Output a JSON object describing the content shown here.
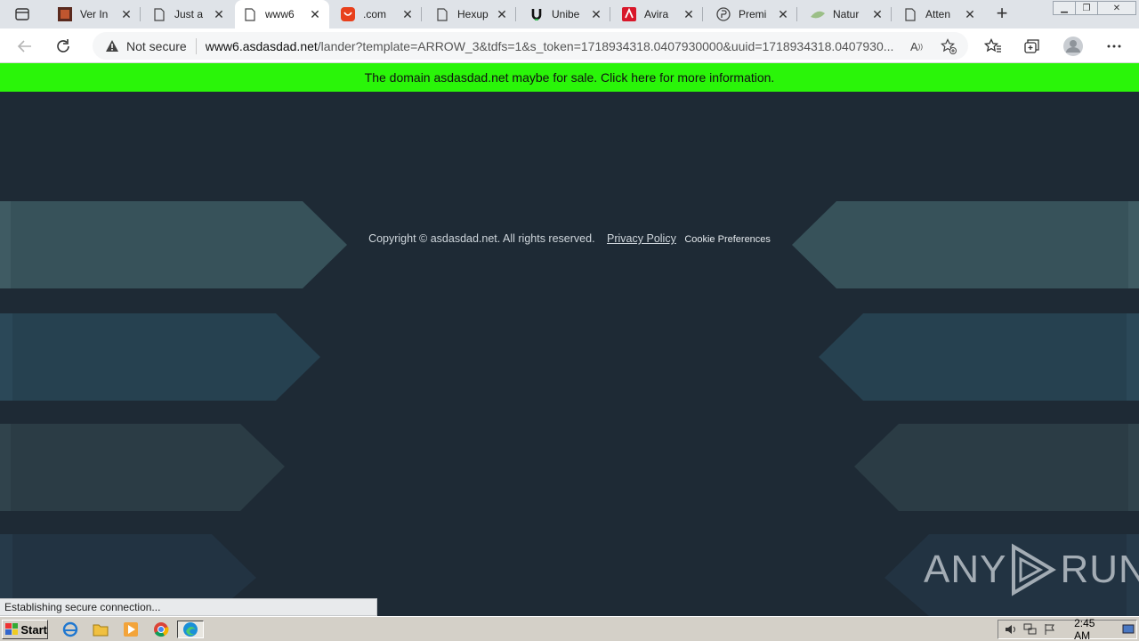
{
  "tabs": [
    {
      "title": "Ver In",
      "icon": "photo-favicon-icon",
      "active": false
    },
    {
      "title": "Just a",
      "icon": "page-icon",
      "active": false
    },
    {
      "title": "www6",
      "icon": "page-icon",
      "active": true
    },
    {
      "title": ".com",
      "icon": "shopping-favicon-icon",
      "active": false
    },
    {
      "title": "Hexup",
      "icon": "page-icon",
      "active": false
    },
    {
      "title": "Unibe",
      "icon": "unibet-favicon-icon",
      "active": false
    },
    {
      "title": "Avira",
      "icon": "avira-favicon-icon",
      "active": false
    },
    {
      "title": "Premi",
      "icon": "premium-favicon-icon",
      "active": false
    },
    {
      "title": "Natur",
      "icon": "leaf-favicon-icon",
      "active": false
    },
    {
      "title": "Atten",
      "icon": "page-icon",
      "active": false
    }
  ],
  "address": {
    "security_label": "Not secure",
    "url_host": "www6.asdasdad.net",
    "url_path": "/lander?template=ARROW_3&tdfs=1&s_token=1718934318.0407930000&uuid=1718934318.0407930..."
  },
  "banner": {
    "text": "The domain asdasdad.net maybe for sale. Click here for more information.",
    "color": "#2af509"
  },
  "footer": {
    "copyright": "Copyright © asdasdad.net.  All rights reserved.",
    "privacy": "Privacy Policy",
    "cookie": "Cookie Preferences"
  },
  "watermark": {
    "text_left": "ANY",
    "text_right": "RUN"
  },
  "status_bar": "Establishing secure connection...",
  "taskbar": {
    "start_label": "Start",
    "clock": "2:45 AM"
  },
  "colors": {
    "page_bg": "#1e2a35",
    "arrow_1": "#37525a",
    "arrow_2": "#264150",
    "arrow_3": "#2b3c45",
    "arrow_4": "#223342"
  }
}
